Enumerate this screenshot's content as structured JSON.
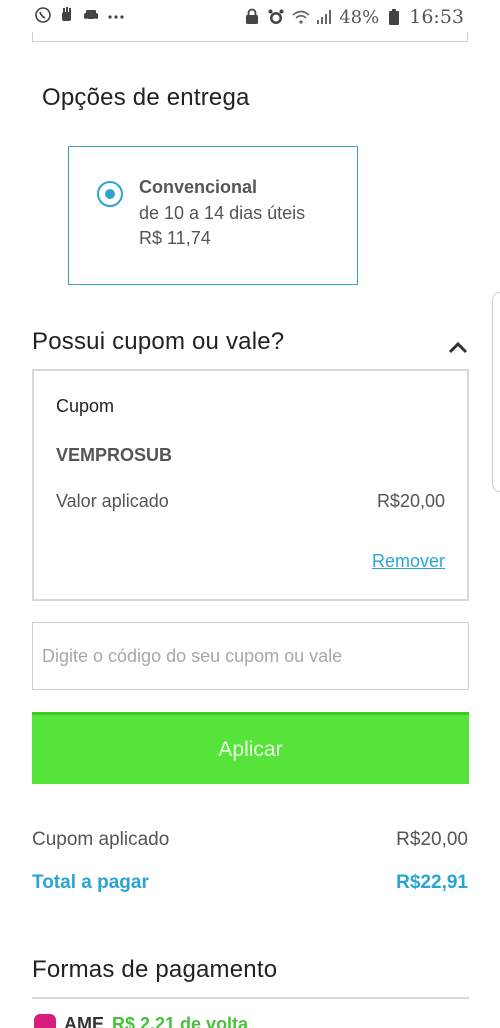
{
  "status_bar": {
    "left_icons": [
      "whatsapp-icon",
      "hand-icon",
      "car-icon",
      "more-icon"
    ],
    "right_icons": [
      "lock-icon",
      "alarm-icon",
      "wifi-icon",
      "signal-icon"
    ],
    "battery": "48%",
    "time": "16:53"
  },
  "delivery": {
    "title": "Opções de entrega",
    "option": {
      "name": "Convencional",
      "days": "de 10 a 14 dias úteis",
      "price": "R$ 11,74",
      "selected": true
    }
  },
  "coupon": {
    "title": "Possui cupom ou vale?",
    "box_label": "Cupom",
    "code": "VEMPROSUB",
    "applied_label": "Valor aplicado",
    "applied_value": "R$20,00",
    "remove_label": "Remover",
    "input_placeholder": "Digite o código do seu cupom ou vale",
    "input_value": "",
    "apply_label": "Aplicar"
  },
  "summary": {
    "coupon_label": "Cupom aplicado",
    "coupon_value": "R$20,00",
    "total_label": "Total a pagar",
    "total_value": "R$22,91"
  },
  "payment": {
    "title": "Formas de pagamento",
    "first_option_partial": "AME",
    "first_option_partial_green": "R$ 2,21 de volta"
  },
  "colors": {
    "accent_blue": "#29a4d3",
    "apply_green": "#56e43a"
  }
}
